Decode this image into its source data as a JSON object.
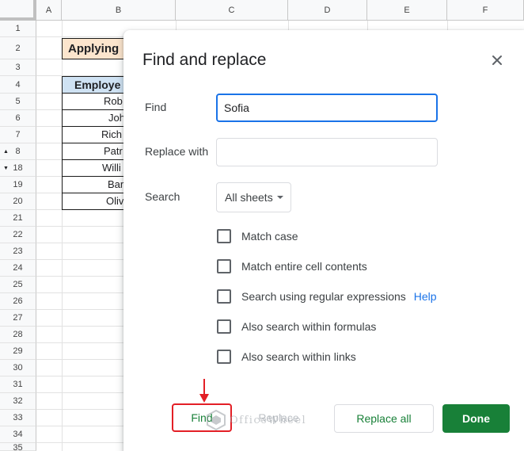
{
  "sheet": {
    "columns": [
      "A",
      "B",
      "C",
      "D",
      "E",
      "F"
    ],
    "rows": [
      "1",
      "2",
      "3",
      "4",
      "5",
      "6",
      "7",
      "8",
      "18",
      "19",
      "20",
      "21",
      "22",
      "23",
      "24",
      "25",
      "26",
      "27",
      "28",
      "29",
      "30",
      "31",
      "32",
      "33",
      "34",
      "35"
    ],
    "title_cell": "Applying",
    "table_header": "Employe",
    "table_cells": [
      "Rob",
      "Joh",
      "Rich",
      "Patr",
      "Willi",
      "Bar",
      "Oliv"
    ]
  },
  "dialog": {
    "title": "Find and replace",
    "find_label": "Find",
    "find_value": "Sofia",
    "replace_label": "Replace with",
    "replace_value": "",
    "search_label": "Search",
    "search_scope": "All sheets",
    "options": [
      {
        "label": "Match case",
        "checked": false
      },
      {
        "label": "Match entire cell contents",
        "checked": false
      },
      {
        "label": "Search using regular expressions",
        "checked": false
      },
      {
        "label": "Also search within formulas",
        "checked": false
      },
      {
        "label": "Also search within links",
        "checked": false
      }
    ],
    "help_link": "Help",
    "buttons": {
      "find": "Find",
      "replace": "Replace",
      "replace_all": "Replace all",
      "done": "Done"
    }
  },
  "watermark": "OfficeWheel",
  "colors": {
    "accent_green": "#188038",
    "focus_blue": "#1a73e8",
    "highlight_red": "#e31f26",
    "title_cell_bg": "#fce5cd",
    "header_cell_bg": "#cfe2f3"
  }
}
